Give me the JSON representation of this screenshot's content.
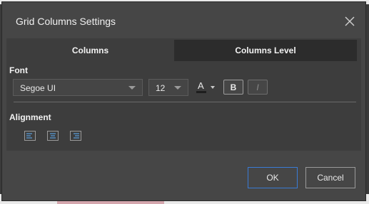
{
  "dialog": {
    "title": "Grid Columns Settings",
    "close_icon": "close-icon"
  },
  "tabs": [
    {
      "label": "Columns",
      "active": true
    },
    {
      "label": "Columns Level",
      "active": false
    }
  ],
  "font": {
    "section_label": "Font",
    "family": "Segoe UI",
    "size": "12",
    "color_button_letter": "A",
    "bold_label": "B",
    "italic_label": "I"
  },
  "alignment": {
    "section_label": "Alignment",
    "icons": [
      "align-left-icon",
      "align-center-icon",
      "align-right-icon"
    ]
  },
  "footer": {
    "ok_label": "OK",
    "cancel_label": "Cancel"
  },
  "colors": {
    "dialog_bg": "#464646",
    "content_bg": "#3d3d3d",
    "inactive_tab_bg": "#2c2c2c",
    "ok_border": "#3a7bd5",
    "icon_accent": "#5aa0e0"
  }
}
